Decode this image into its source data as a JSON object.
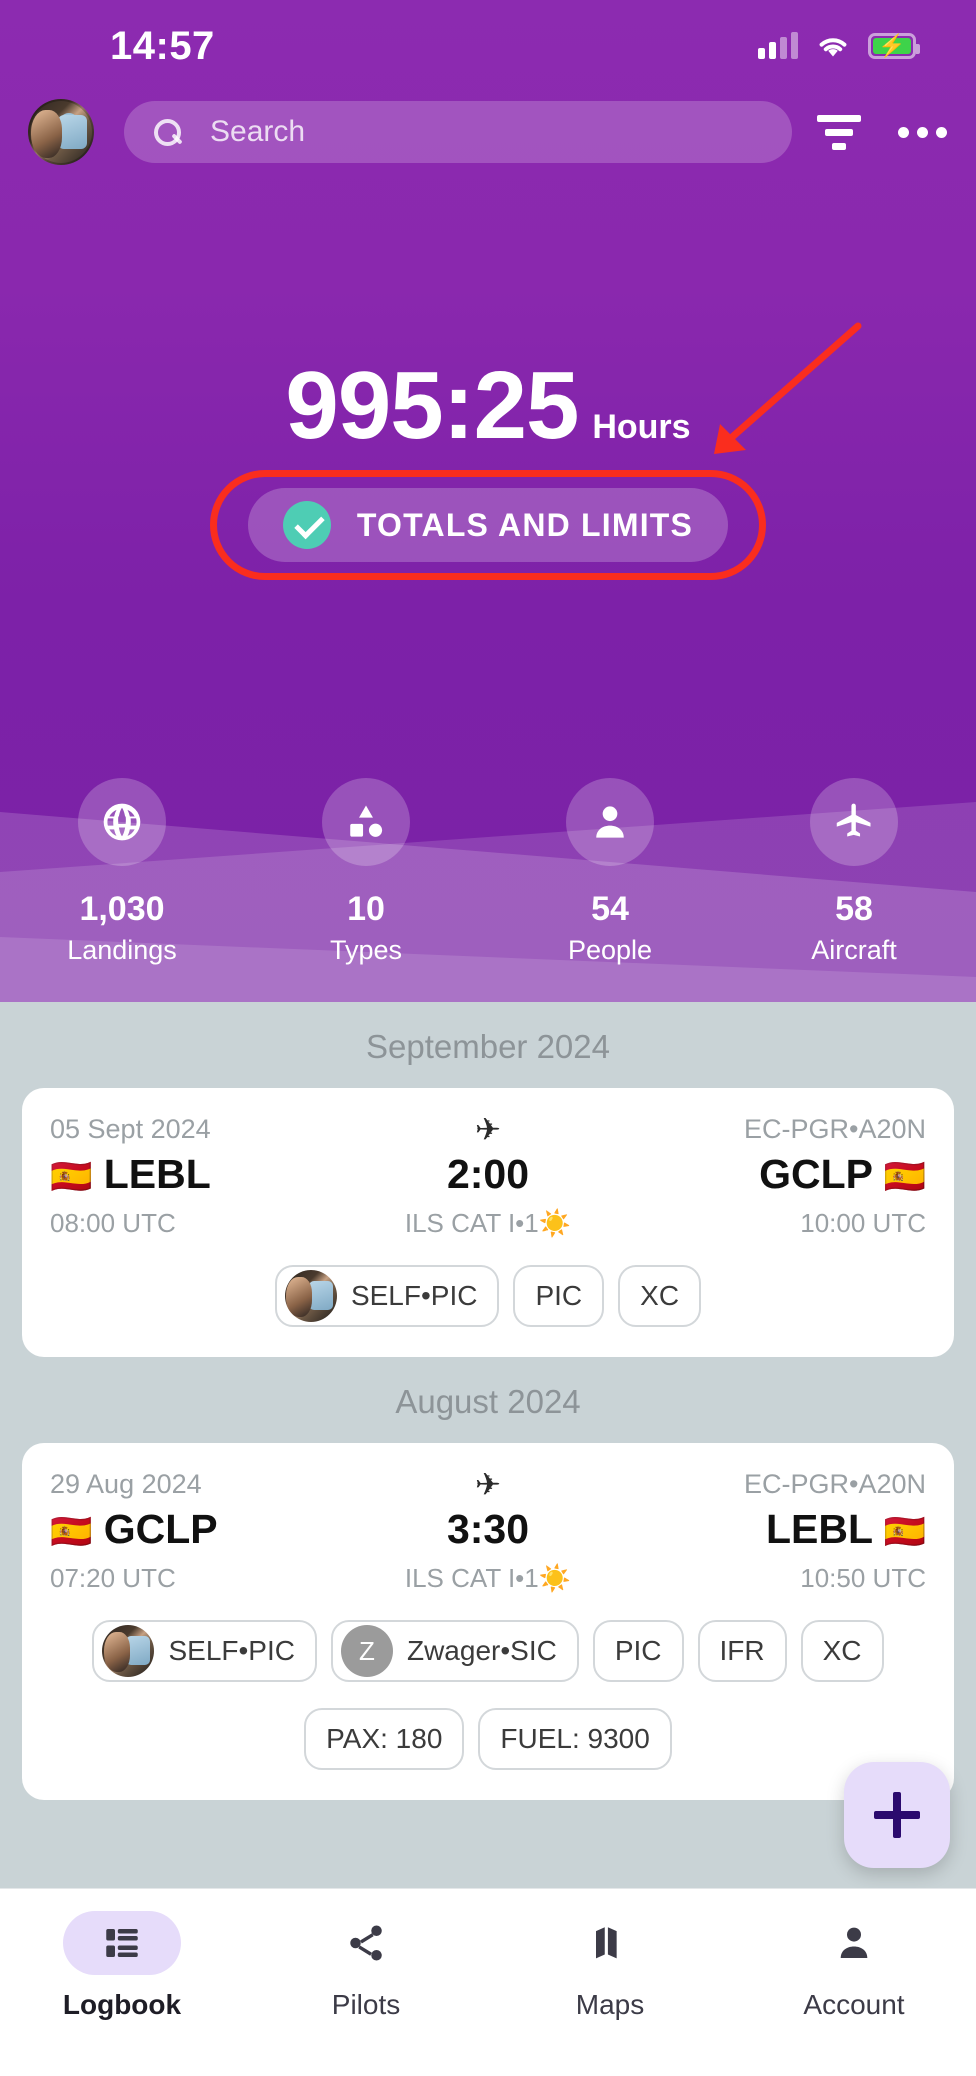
{
  "status_bar": {
    "time": "14:57",
    "signal_icon": "cellular-signal-icon",
    "wifi_icon": "wifi-icon",
    "battery_icon": "battery-charging-icon"
  },
  "header": {
    "avatar_name": "user-avatar",
    "search_placeholder": "Search",
    "search_value": "",
    "filter_label": "filter-icon",
    "overflow_label": "more-options-icon"
  },
  "hero": {
    "total_hours": "995:25",
    "hours_unit": "Hours",
    "totals_button_label": "TOTALS AND LIMITS",
    "accent_check_color": "#4ecdb4",
    "background_color": "#8a28ae",
    "annotation_color": "#fa2d1e"
  },
  "stats": [
    {
      "icon": "globe-icon",
      "value": "1,030",
      "label": "Landings"
    },
    {
      "icon": "shapes-icon",
      "value": "10",
      "label": "Types"
    },
    {
      "icon": "person-icon",
      "value": "54",
      "label": "People"
    },
    {
      "icon": "airplane-icon",
      "value": "58",
      "label": "Aircraft"
    }
  ],
  "sections": [
    {
      "month": "September 2024",
      "flight": {
        "date": "05 Sept 2024",
        "aircraft": "EC-PGR•A20N",
        "plane_icon": "airplane-icon",
        "dep_flag": "🇪🇸",
        "dep_icao": "LEBL",
        "dep_time": "08:00 UTC",
        "duration": "2:00",
        "approach": "ILS CAT I•1",
        "approach_icon": "☀️",
        "arr_flag": "🇪🇸",
        "arr_icao": "GCLP",
        "arr_time": "10:00 UTC",
        "chips": [
          {
            "type": "avatar-photo",
            "label": "SELF•PIC"
          },
          {
            "type": "plain",
            "label": "PIC"
          },
          {
            "type": "plain",
            "label": "XC"
          }
        ]
      }
    },
    {
      "month": "August 2024",
      "flight": {
        "date": "29 Aug 2024",
        "aircraft": "EC-PGR•A20N",
        "plane_icon": "airplane-icon",
        "dep_flag": "🇪🇸",
        "dep_icao": "GCLP",
        "dep_time": "07:20 UTC",
        "duration": "3:30",
        "approach": "ILS CAT I•1",
        "approach_icon": "☀️",
        "arr_flag": "🇪🇸",
        "arr_icao": "LEBL",
        "arr_time": "10:50 UTC",
        "chips": [
          {
            "type": "avatar-photo",
            "label": "SELF•PIC"
          },
          {
            "type": "avatar-letter",
            "letter": "Z",
            "label": "Zwager•SIC"
          },
          {
            "type": "plain",
            "label": "PIC"
          },
          {
            "type": "plain",
            "label": "IFR"
          },
          {
            "type": "plain",
            "label": "XC"
          }
        ],
        "chips_row2": [
          {
            "type": "plain",
            "label": "PAX: 180"
          },
          {
            "type": "plain",
            "label": "FUEL: 9300"
          }
        ]
      }
    }
  ],
  "fab": {
    "label": "+",
    "name": "add-flight-button",
    "color": "#e6dcfa"
  },
  "bottom_nav": [
    {
      "icon": "logbook-list-icon",
      "label": "Logbook",
      "active": true
    },
    {
      "icon": "share-nodes-icon",
      "label": "Pilots",
      "active": false
    },
    {
      "icon": "map-icon",
      "label": "Maps",
      "active": false
    },
    {
      "icon": "person-icon",
      "label": "Account",
      "active": false
    }
  ]
}
